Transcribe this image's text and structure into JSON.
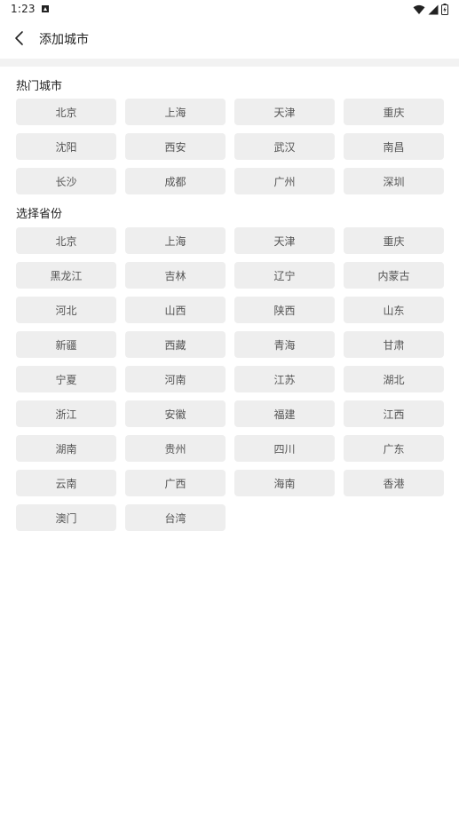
{
  "status_bar": {
    "time": "1:23"
  },
  "header": {
    "title": "添加城市"
  },
  "hot_cities": {
    "title": "热门城市",
    "items": [
      "北京",
      "上海",
      "天津",
      "重庆",
      "沈阳",
      "西安",
      "武汉",
      "南昌",
      "长沙",
      "成都",
      "广州",
      "深圳"
    ]
  },
  "provinces": {
    "title": "选择省份",
    "items": [
      "北京",
      "上海",
      "天津",
      "重庆",
      "黑龙江",
      "吉林",
      "辽宁",
      "内蒙古",
      "河北",
      "山西",
      "陕西",
      "山东",
      "新疆",
      "西藏",
      "青海",
      "甘肃",
      "宁夏",
      "河南",
      "江苏",
      "湖北",
      "浙江",
      "安徽",
      "福建",
      "江西",
      "湖南",
      "贵州",
      "四川",
      "广东",
      "云南",
      "广西",
      "海南",
      "香港",
      "澳门",
      "台湾"
    ]
  }
}
